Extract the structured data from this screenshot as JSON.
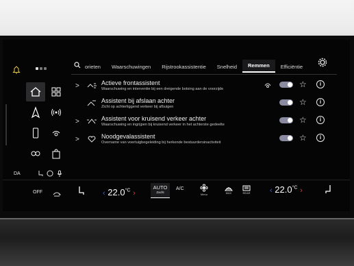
{
  "header": {
    "tabs": [
      {
        "label": "orieten",
        "active": false
      },
      {
        "label": "Waarschuwingen",
        "active": false
      },
      {
        "label": "Rijstrookassistentie",
        "active": false
      },
      {
        "label": "Snelheid",
        "active": false
      },
      {
        "label": "Remmen",
        "active": true
      },
      {
        "label": "Efficiëntie",
        "active": false
      }
    ]
  },
  "rows": [
    {
      "title": "Actieve frontassistent",
      "subtitle": "Waarschuwing en interventie bij een dreigende botsing aan de voorzijde",
      "enabled": true,
      "favorite": false,
      "icon": "front-assist-icon"
    },
    {
      "title": "Assistent bij afslaan achter",
      "subtitle": "Zicht op achterliggend verkeer bij afbuigen",
      "enabled": true,
      "favorite": false,
      "icon": "turn-assist-icon"
    },
    {
      "title": "Assistent voor kruisend verkeer achter",
      "subtitle": "Waarschuwing en ingrijpen bij kruisend verkeer in het achterste gedeelte",
      "enabled": true,
      "favorite": false,
      "icon": "cross-traffic-icon"
    },
    {
      "title": "Noodgevalassistent",
      "subtitle": "Overname van voertuigbegeleiding bij herkende bestuurdersinactiviteit",
      "enabled": true,
      "favorite": false,
      "icon": "emergency-assist-icon"
    }
  ],
  "status": {
    "language": "DA"
  },
  "climate": {
    "off_label": "OFF",
    "left_temp": "22.0",
    "right_temp": "22.0",
    "unit": "°C",
    "auto_label": "AUTO",
    "auto_sub": "Zacht",
    "ac_label": "A/C",
    "menu_label": "Menu",
    "max_label": "MAX",
    "rear_label": "REAR"
  },
  "colors": {
    "accent": "#ffffff",
    "toggle": "#8a8aa0",
    "warm": "#d04040",
    "cool": "#4060d0"
  }
}
